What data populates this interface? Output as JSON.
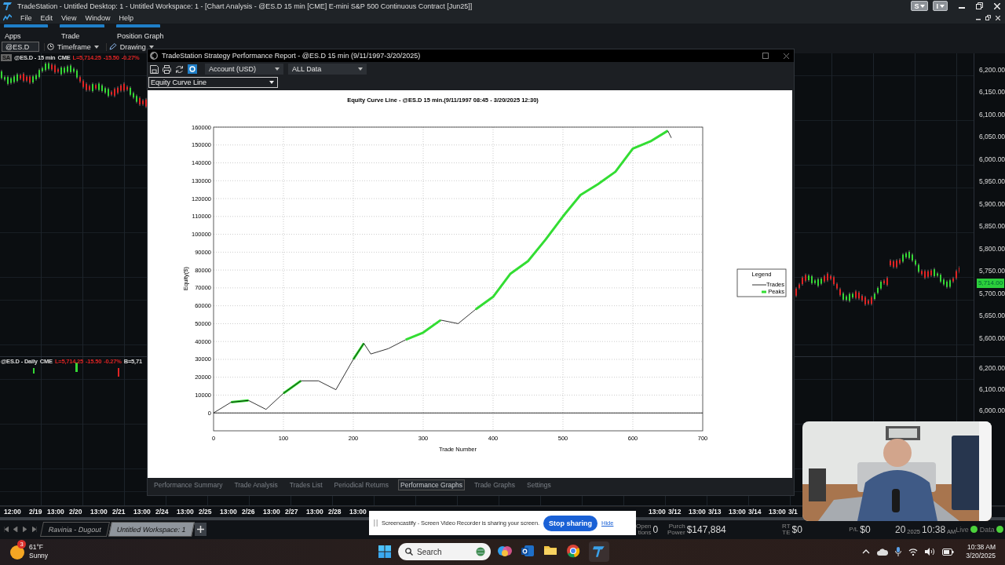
{
  "app": {
    "title": "TradeStation - Untitled Desktop: 1 - Untitled Workspace: 1 - [Chart Analysis - @ES.D 15 min [CME] E-mini S&P 500 Continuous Contract [Jun25]]",
    "user_buttons": [
      "S",
      "I"
    ]
  },
  "menu": [
    "File",
    "Edit",
    "View",
    "Window",
    "Help"
  ],
  "apps_bar": [
    "Apps",
    "Trade",
    "Position Graph"
  ],
  "chart_toolbar": {
    "symbol": "@ES.D",
    "buttons": [
      "Timeframe",
      "Drawing"
    ]
  },
  "main_chart": {
    "legend": {
      "badge": "SA",
      "symbol": "@ES.D - 15 min",
      "exchange": "CME",
      "last": "L=5,714.25",
      "change": "-15.50",
      "percent": "-0.27%"
    },
    "lower_legend": {
      "symbol": "@ES.D - Daily",
      "exchange": "CME",
      "last": "L=5,714.25",
      "change": "-15.50",
      "percent": "-0.27%",
      "bid": "B=5,71"
    },
    "price_axis": [
      "6,200.00",
      "6,150.00",
      "6,100.00",
      "6,050.00",
      "6,000.00",
      "5,950.00",
      "5,900.00",
      "5,850.00",
      "5,800.00",
      "5,750.00",
      "5,700.00",
      "5,650.00",
      "5,600.00"
    ],
    "price_tag": "5,714.00",
    "lower_price_axis": [
      "6,200.00",
      "6,100.00",
      "6,000.00"
    ],
    "time_axis_left": [
      {
        "time": "12:00",
        "date": "2/19"
      },
      {
        "time": "13:00",
        "date": "2/20"
      },
      {
        "time": "13:00",
        "date": "2/21"
      },
      {
        "time": "13:00",
        "date": "2/24"
      },
      {
        "time": "13:00",
        "date": "2/25"
      },
      {
        "time": "13:00",
        "date": "2/26"
      },
      {
        "time": "13:00",
        "date": "2/27"
      },
      {
        "time": "13:00",
        "date": "2/28"
      },
      {
        "time": "13:00"
      }
    ],
    "time_axis_right": [
      {
        "time": "13:00",
        "date": "3/12"
      },
      {
        "time": "13:00",
        "date": "3/13"
      },
      {
        "time": "13:00",
        "date": "3/14"
      },
      {
        "time": "13:00",
        "date": "3/1"
      }
    ]
  },
  "report": {
    "title": "TradeStation Strategy Performance Report - @ES.D 15 min (9/11/1997-3/20/2025)",
    "account": "Account (USD)",
    "range": "ALL Data",
    "graph_select": "Equity Curve Line",
    "chart_data": {
      "type": "line",
      "title": "Equity Curve Line - @ES.D 15 min.(9/11/1997 08:45 - 3/20/2025 12:30)",
      "xlabel": "Trade Number",
      "ylabel": "Equity($)",
      "x": [
        0,
        25,
        50,
        75,
        100,
        125,
        150,
        175,
        200,
        215,
        225,
        250,
        275,
        300,
        325,
        350,
        375,
        400,
        425,
        450,
        475,
        500,
        525,
        550,
        575,
        600,
        625,
        650,
        655
      ],
      "series": [
        {
          "name": "Trades",
          "color": "#000000",
          "values": [
            0,
            6000,
            7000,
            2000,
            11000,
            18000,
            18000,
            13000,
            30000,
            39000,
            33000,
            36000,
            41000,
            null,
            52000,
            50000,
            58000,
            null,
            null,
            null,
            null,
            null,
            null,
            null,
            null,
            null,
            null,
            158000,
            154000
          ]
        },
        {
          "name": "Peaks",
          "color": "#33dd33",
          "values": [
            null,
            6000,
            7000,
            null,
            11000,
            18000,
            null,
            null,
            30000,
            39000,
            null,
            null,
            41000,
            45000,
            52000,
            null,
            58000,
            65000,
            78000,
            85000,
            97000,
            110000,
            122000,
            128000,
            135000,
            148000,
            152000,
            158000,
            null
          ]
        }
      ],
      "xlim": [
        0,
        700
      ],
      "ylim": [
        -10000,
        160000
      ],
      "grid": true,
      "legend": true,
      "xticks": [
        0,
        100,
        200,
        300,
        400,
        500,
        600,
        700
      ],
      "yticks": [
        0,
        10000,
        20000,
        30000,
        40000,
        50000,
        60000,
        70000,
        80000,
        90000,
        100000,
        110000,
        120000,
        130000,
        140000,
        150000,
        160000
      ]
    },
    "legend_title": "Legend",
    "tabs": [
      {
        "label": "Performance Summary",
        "selected": false
      },
      {
        "label": "Trade Analysis",
        "selected": false
      },
      {
        "label": "Trades List",
        "selected": false
      },
      {
        "label": "Periodical Returns",
        "selected": false
      },
      {
        "label": "Performance Graphs",
        "selected": true
      },
      {
        "label": "Trade Graphs",
        "selected": false
      },
      {
        "label": "Settings",
        "selected": false
      }
    ]
  },
  "workspace_tabs": [
    {
      "label": "Ravinia - Dugout",
      "selected": false
    },
    {
      "label": "Untitled Workspace: 1",
      "selected": true
    }
  ],
  "status": {
    "items": [
      {
        "label_lines": [
          "Open",
          "tions"
        ],
        "value": "0"
      },
      {
        "label_lines": [
          "Purch",
          "Power"
        ],
        "value": "$147,884"
      },
      {
        "label_lines": [
          "RT",
          "TE"
        ],
        "value": "$0"
      },
      {
        "label_lines": [
          "P/L"
        ],
        "value": "$0"
      }
    ],
    "date_day": "20",
    "date_year": "2025",
    "time": "10:38",
    "ampm": "AM",
    "indicators": [
      "Live",
      "Data"
    ]
  },
  "share_bar": {
    "message": "Screencastify - Screen Video Recorder is sharing your screen.",
    "stop": "Stop sharing",
    "hide": "Hide"
  },
  "webcam": {
    "kind": "picture"
  },
  "taskbar": {
    "weather": {
      "badge": "3",
      "temp": "61°F",
      "condition": "Sunny"
    },
    "search": {
      "placeholder": "Search"
    },
    "clock": {
      "time": "10:38 AM",
      "date": "3/20/2025"
    }
  }
}
